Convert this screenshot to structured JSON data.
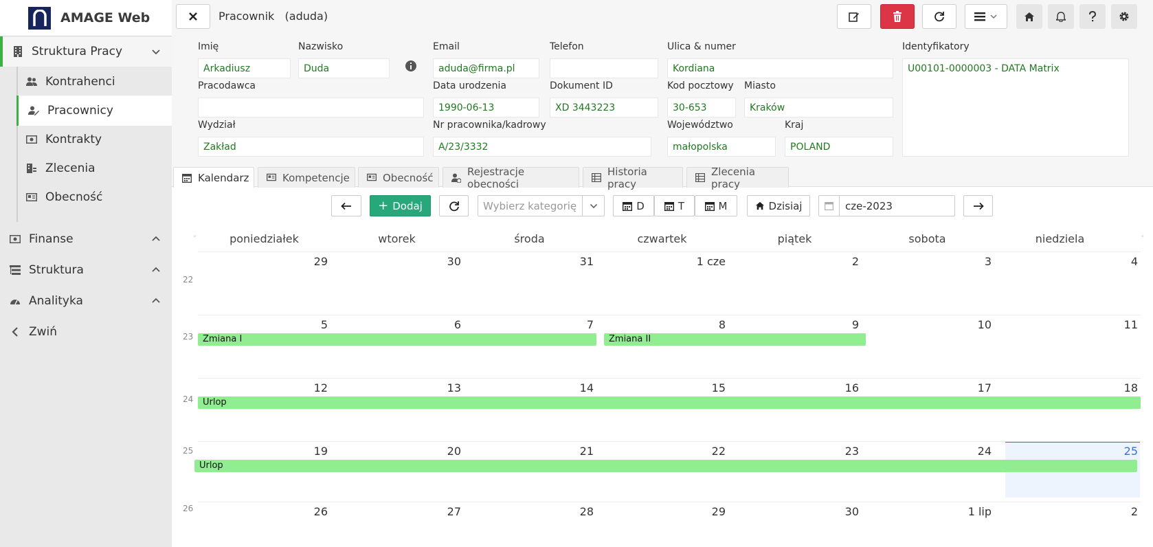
{
  "app": {
    "title": "AMAGE Web"
  },
  "sidebar": {
    "sections": [
      {
        "label": "Struktura Pracy",
        "icon": "building-icon",
        "expanded": true
      },
      {
        "label": "Finanse",
        "icon": "money-icon",
        "expanded": false
      },
      {
        "label": "Struktura",
        "icon": "tree-icon",
        "expanded": false
      },
      {
        "label": "Analityka",
        "icon": "gauge-icon",
        "expanded": false
      },
      {
        "label": "Zwiń",
        "icon": "chevron-left-icon"
      }
    ],
    "items": [
      {
        "label": "Kontrahenci",
        "icon": "users-icon"
      },
      {
        "label": "Pracownicy",
        "icon": "user-edit-icon",
        "active": true
      },
      {
        "label": "Kontrakty",
        "icon": "money-bill-icon"
      },
      {
        "label": "Zlecenia",
        "icon": "building-list-icon"
      },
      {
        "label": "Obecność",
        "icon": "id-card-icon"
      }
    ]
  },
  "header": {
    "title_type": "Pracownik",
    "title_login": "(aduda)"
  },
  "form": {
    "first_name": {
      "label": "Imię",
      "value": "Arkadiusz"
    },
    "last_name": {
      "label": "Nazwisko",
      "value": "Duda"
    },
    "email": {
      "label": "Email",
      "value": "aduda@firma.pl"
    },
    "phone": {
      "label": "Telefon",
      "value": ""
    },
    "street": {
      "label": "Ulica & numer",
      "value": "Kordiana"
    },
    "identifiers": {
      "label": "Identyfikatory",
      "value": "U00101-0000003 - DATA Matrix"
    },
    "employer": {
      "label": "Pracodawca",
      "value": ""
    },
    "birth_date": {
      "label": "Data urodzenia",
      "value": "1990-06-13"
    },
    "document_id": {
      "label": "Dokument ID",
      "value": "XD 3443223"
    },
    "postal_code": {
      "label": "Kod pocztowy",
      "value": "30-653"
    },
    "city": {
      "label": "Miasto",
      "value": "Kraków"
    },
    "department": {
      "label": "Wydział",
      "value": "Zakład"
    },
    "employee_no": {
      "label": "Nr pracownika/kadrowy",
      "value": "A/23/3332"
    },
    "voivodeship": {
      "label": "Województwo",
      "value": "małopolska"
    },
    "country": {
      "label": "Kraj",
      "value": "POLAND"
    }
  },
  "tabs": [
    {
      "label": "Kalendarz",
      "icon": "calendar-icon",
      "active": true
    },
    {
      "label": "Kompetencje",
      "icon": "id-card-icon"
    },
    {
      "label": "Obecność",
      "icon": "id-card-icon"
    },
    {
      "label": "Rejestracje obecności",
      "icon": "user-clock-icon"
    },
    {
      "label": "Historia pracy",
      "icon": "list-icon"
    },
    {
      "label": "Zlecenia pracy",
      "icon": "list-icon"
    }
  ],
  "toolbar": {
    "add_label": "Dodaj",
    "category_placeholder": "Wybierz kategorię",
    "view_day": "D",
    "view_week": "T",
    "view_month": "M",
    "today_label": "Dzisiaj",
    "month_value": "cze-2023"
  },
  "calendar": {
    "day_names": [
      "poniedziałek",
      "wtorek",
      "środa",
      "czwartek",
      "piątek",
      "sobota",
      "niedziela"
    ],
    "weeks": [
      {
        "num": "22",
        "days": [
          "29",
          "30",
          "31",
          "1 cze",
          "2",
          "3",
          "4"
        ]
      },
      {
        "num": "23",
        "days": [
          "5",
          "6",
          "7",
          "8",
          "9",
          "10",
          "11"
        ]
      },
      {
        "num": "24",
        "days": [
          "12",
          "13",
          "14",
          "15",
          "16",
          "17",
          "18"
        ]
      },
      {
        "num": "25",
        "days": [
          "19",
          "20",
          "21",
          "22",
          "23",
          "24",
          "25"
        ]
      },
      {
        "num": "26",
        "days": [
          "26",
          "27",
          "28",
          "29",
          "30",
          "1 lip",
          "2"
        ]
      }
    ],
    "events": [
      {
        "title": "Zmiana I"
      },
      {
        "title": "Zmiana II"
      },
      {
        "title": "Urlop"
      },
      {
        "title": "Urlop"
      }
    ],
    "colors": {
      "event": "#90ee90",
      "today": "#3a6fd8",
      "today_bg": "#eef4fd"
    }
  }
}
